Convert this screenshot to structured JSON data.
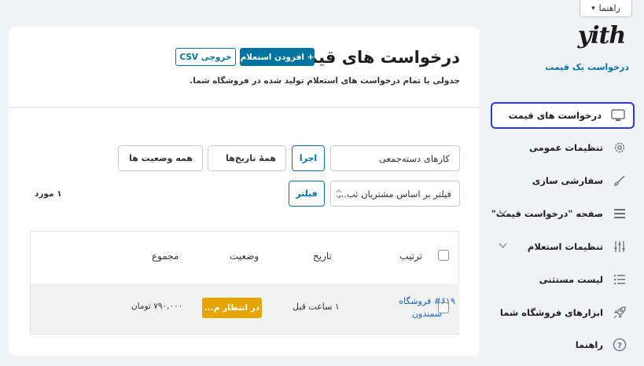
{
  "help_tab": {
    "label": "راهنما",
    "arrow": "▾"
  },
  "sidebar": {
    "logo": "yith",
    "subtitle": "درخواست یک قیمت",
    "items": [
      {
        "label": "درخواست های قیمت",
        "icon": "monitor-icon",
        "active": true
      },
      {
        "label": "تنظیمات عمومی",
        "icon": "gear-icon"
      },
      {
        "label": "سفارشی سازی",
        "icon": "brush-icon"
      },
      {
        "label": "صفحه \"درخواست قیمت\"",
        "icon": "list-icon",
        "chevron": true
      },
      {
        "label": "تنظیمات استعلام",
        "icon": "sliders-icon",
        "chevron": true
      },
      {
        "label": "لیست مستثنی",
        "icon": "bullet-list-icon"
      },
      {
        "label": "ابزارهای فروشگاه شما",
        "icon": "rocket-icon"
      },
      {
        "label": "راهنما",
        "icon": "help-circle-icon"
      }
    ]
  },
  "main": {
    "title": "درخواست های قیمت",
    "add_button": "+ افزودن استعلام",
    "csv_button": "خروجی CSV",
    "description": "جدولی با تمام درخواست های استعلام تولید شده در فروشگاه شما.",
    "bulk_actions": "کارهای دسته‌جمعی",
    "apply_button": "اجرا",
    "all_dates": "همهٔ تاریخ‌ها",
    "all_statuses": "همه وضعیت ها",
    "customer_filter": "فیلتر بر اساس مشتریان ثب...",
    "filter_button": "فیلتر",
    "item_count": "۱ مورد"
  },
  "table": {
    "headers": {
      "order": "ترتیب",
      "date": "تاریخ",
      "status": "وضعیت",
      "total": "مجموع"
    },
    "rows": [
      {
        "order": "#۶۱۹ فروشگاه سمندون",
        "date": "۱ ساعت قبل",
        "status": "در انتظار م...",
        "total": "۷۹۰,۰۰۰ تومان"
      }
    ]
  },
  "colors": {
    "accent": "#00739e",
    "pending": "#e5a500",
    "active_outline": "#2d3bd1",
    "link": "#1a63c9"
  }
}
